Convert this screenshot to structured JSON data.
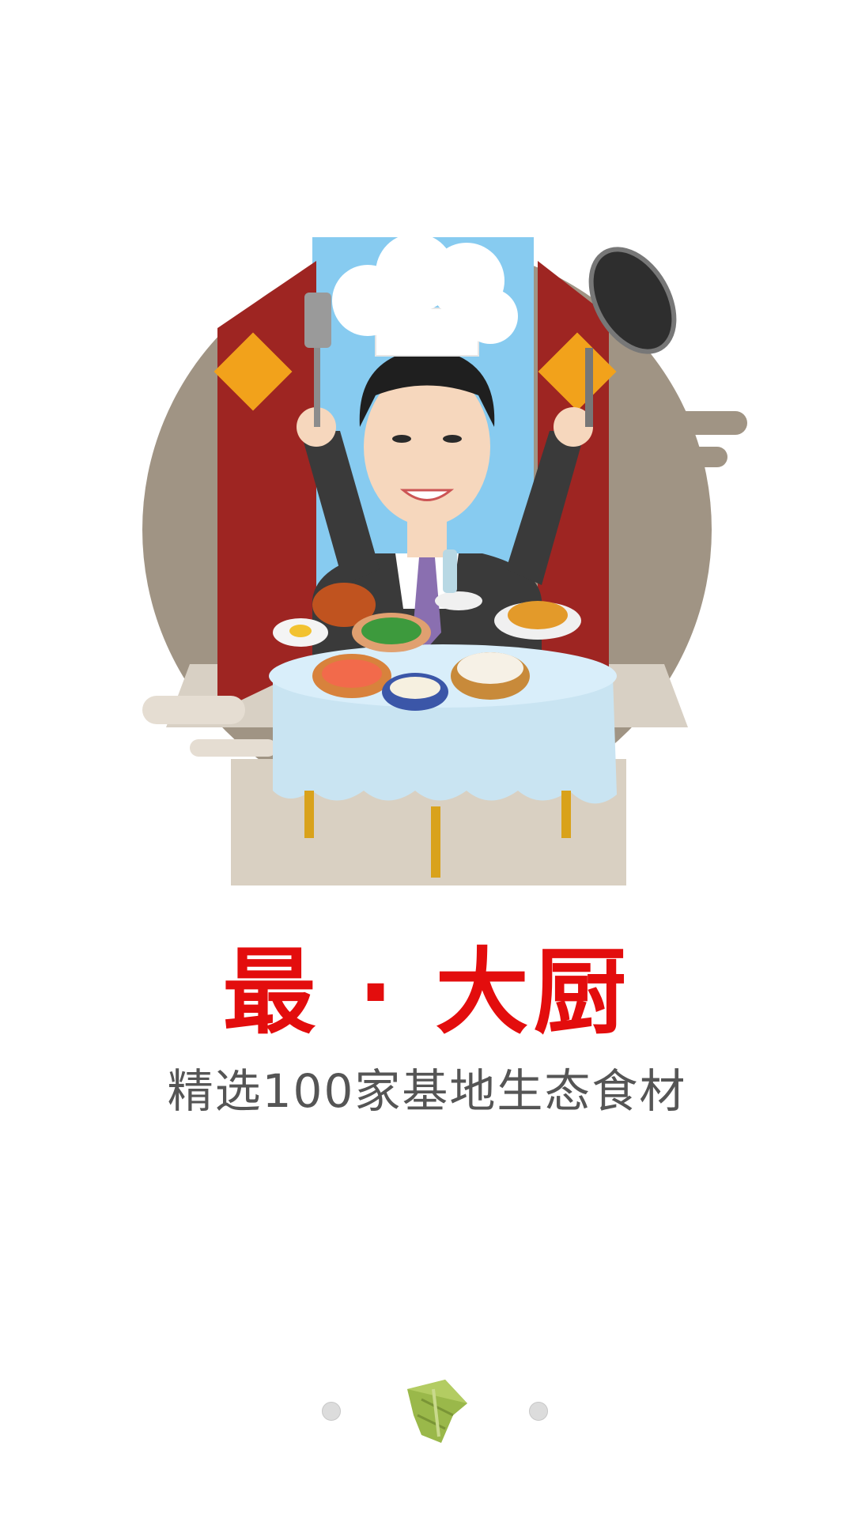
{
  "splash": {
    "title": "最 · 大厨",
    "subtitle": "精选100家基地生态食材"
  },
  "pager": {
    "page_count": 3,
    "current_page": 2,
    "active_indicator_icon": "zongzi-icon"
  },
  "colors": {
    "title": "#e30d0d",
    "subtitle": "#555555",
    "dot_inactive": "#dcdcdc",
    "zongzi": "#9ab84a",
    "circle_bg": "#a09484",
    "curtain": "#9e2522",
    "sky": "#87cbf0",
    "tablecloth": "#c9e4f2"
  }
}
